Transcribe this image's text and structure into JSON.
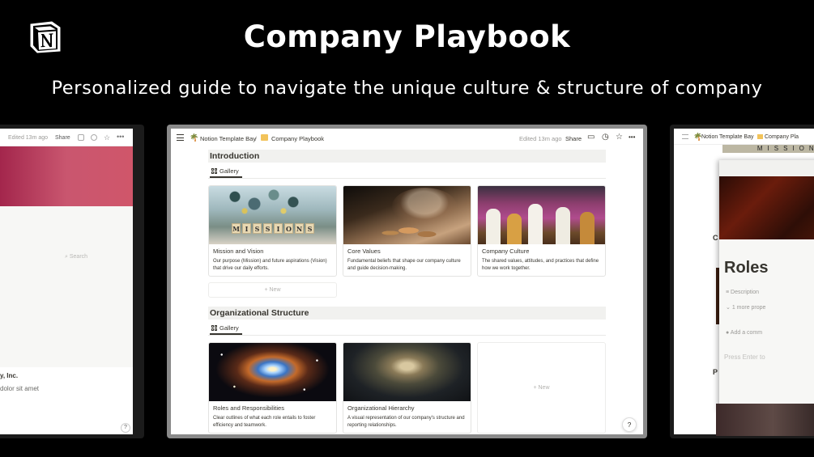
{
  "banner": {
    "title": "Company Playbook",
    "subtitle": "Personalized guide to navigate the unique culture & structure of company"
  },
  "window": {
    "breadcrumb": [
      "Notion Template Bay",
      "Company Playbook"
    ],
    "edited": "Edited 13m ago",
    "share": "Share",
    "help": "?"
  },
  "sections": [
    {
      "title": "Introduction",
      "view": "Gallery",
      "cards": [
        {
          "title": "Mission and Vision",
          "description": "Our purpose (Mission) and future aspirations (Vision) that drive our daily efforts.",
          "image_text": "MISSIONS"
        },
        {
          "title": "Core Values",
          "description": "Fundamental beliefs that shape our company culture and guide decision-making."
        },
        {
          "title": "Company Culture",
          "description": "The shared values, attitudes, and practices that define how we work together."
        }
      ],
      "new_label": "+ New"
    },
    {
      "title": "Organizational Structure",
      "view": "Gallery",
      "cards": [
        {
          "title": "Roles and Responsibilities",
          "description": "Clear outlines of what each role entails to foster efficiency and teamwork."
        },
        {
          "title": "Organizational Hierarchy",
          "description": "A visual representation of our company's structure and reporting relationships."
        }
      ],
      "new_label": "+ New"
    }
  ],
  "left_panel": {
    "edited": "Edited 13m ago",
    "share": "Share",
    "search": "Search",
    "company": "y, Inc.",
    "lorem": "dolor sit amet",
    "help": "?"
  },
  "right_panel": {
    "breadcrumb": [
      "Notion Template Bay",
      "Company Pla"
    ],
    "image_text": "MISSIONS",
    "modal_title": "Roles",
    "description_label": "Description",
    "property": "1 more prope",
    "comment": "Add a comm",
    "press": "Press Enter to",
    "letter_c": "C",
    "letter_p": "P"
  }
}
